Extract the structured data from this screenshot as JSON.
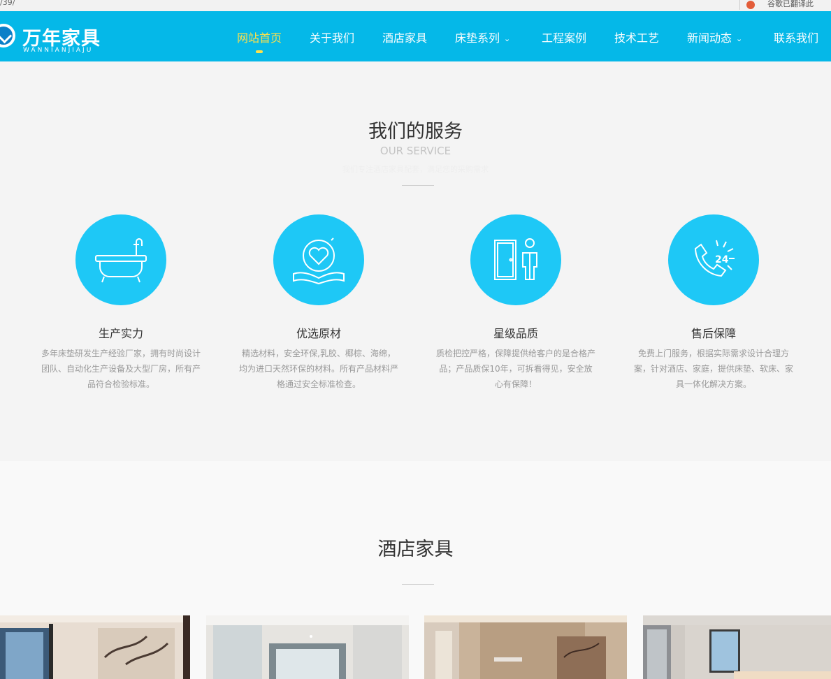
{
  "browser": {
    "url_fragment": "/39/",
    "extension_text": "谷歌已翻译此"
  },
  "header": {
    "logo_cn": "万年家具",
    "logo_en": "WANNIANJIAJU",
    "nav": [
      {
        "label": "网站首页",
        "active": true,
        "dropdown": false
      },
      {
        "label": "关于我们",
        "active": false,
        "dropdown": false
      },
      {
        "label": "酒店家具",
        "active": false,
        "dropdown": false
      },
      {
        "label": "床垫系列",
        "active": false,
        "dropdown": true
      },
      {
        "label": "工程案例",
        "active": false,
        "dropdown": false
      },
      {
        "label": "技术工艺",
        "active": false,
        "dropdown": false
      },
      {
        "label": "新闻动态",
        "active": false,
        "dropdown": true
      },
      {
        "label": "联系我们",
        "active": false,
        "dropdown": false
      }
    ],
    "nav_chevron": "⌄"
  },
  "service": {
    "title": "我们的服务",
    "subtitle": "OUR SERVICE",
    "tiny": "我们专注酒店家具配套，满足您的采购需求",
    "items": [
      {
        "icon": "bathtub-icon",
        "title": "生产实力",
        "desc": "多年床垫研发生产经验厂家，拥有时尚设计团队、自动化生产设备及大型厂房，所有产品符合检验标准。"
      },
      {
        "icon": "heart-book-icon",
        "title": "优选原材",
        "desc": "精选材料，安全环保,乳胶、椰棕、海绵，均为进口天然环保的材料。所有产品材料严格通过安全标准检查。"
      },
      {
        "icon": "door-person-icon",
        "title": "星级品质",
        "desc": "质检把控严格，保障提供给客户的是合格产品；产品质保10年，可拆看得见，安全放心有保障！"
      },
      {
        "icon": "phone-24-icon",
        "title": "售后保障",
        "desc": "免费上门服务，根据实际需求设计合理方案，针对酒店、家庭，提供床垫、软床、家具一体化解决方案。"
      }
    ]
  },
  "hotel": {
    "title": "酒店家具"
  },
  "colors": {
    "brand": "#05b8e8",
    "accent": "#ffe14a",
    "circle": "#1ec8f6"
  }
}
